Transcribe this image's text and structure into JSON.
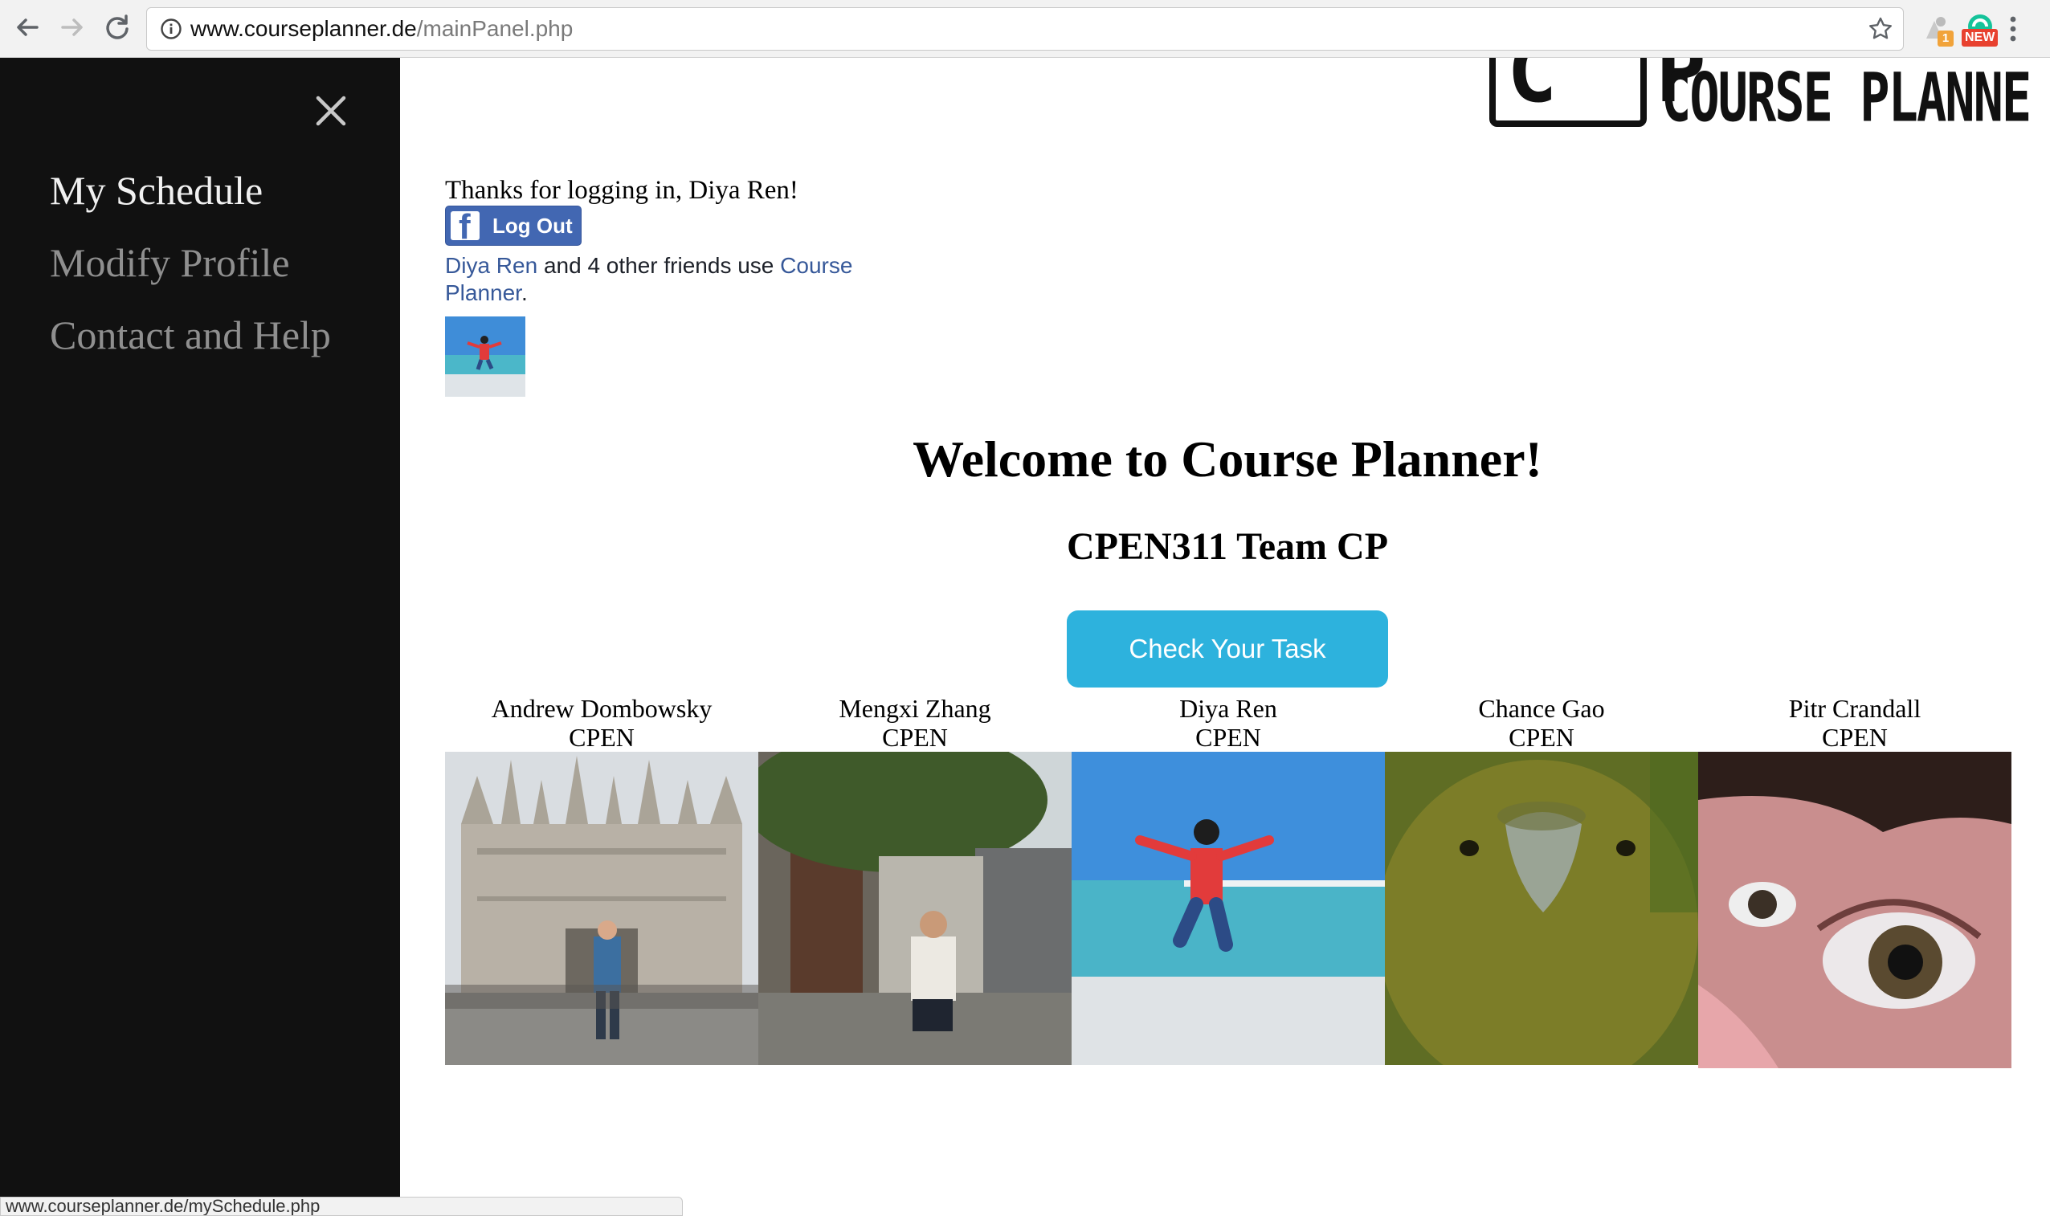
{
  "browser": {
    "url_host": "www.courseplanner.de",
    "url_path": "/mainPanel.php",
    "extension_badge_count": "1",
    "extension_badge_new": "NEW",
    "status_url": "www.courseplanner.de/mySchedule.php"
  },
  "sidebar": {
    "items": [
      {
        "label": "My Schedule",
        "active": true
      },
      {
        "label": "Modify Profile",
        "active": false
      },
      {
        "label": "Contact and Help",
        "active": false
      }
    ]
  },
  "logo": {
    "letters": "C P",
    "word": "COURSE PLANNER"
  },
  "greeting": "Thanks for logging in, Diya Ren!",
  "facebook": {
    "logout_label": "Log Out",
    "friends_link_name": "Diya Ren",
    "friends_text": " and 4 other friends use ",
    "friends_app_link": "Course Planner",
    "friends_end": "."
  },
  "main": {
    "welcome": "Welcome to Course Planner!",
    "team": "CPEN311 Team CP",
    "task_button": "Check Your Task"
  },
  "team_members": [
    {
      "name": "Andrew Dombowsky",
      "dept": "CPEN",
      "photo": "cathedral-photo"
    },
    {
      "name": "Mengxi Zhang",
      "dept": "CPEN",
      "photo": "alley-photo"
    },
    {
      "name": "Diya Ren",
      "dept": "CPEN",
      "photo": "beach-photo"
    },
    {
      "name": "Chance Gao",
      "dept": "CPEN",
      "photo": "parrot-photo"
    },
    {
      "name": "Pitr Crandall",
      "dept": "CPEN",
      "photo": "eye-photo"
    }
  ],
  "colors": {
    "sidebar_bg": "#111111",
    "task_button": "#2db2dd",
    "facebook_blue": "#4267b2",
    "link_blue": "#365899"
  }
}
